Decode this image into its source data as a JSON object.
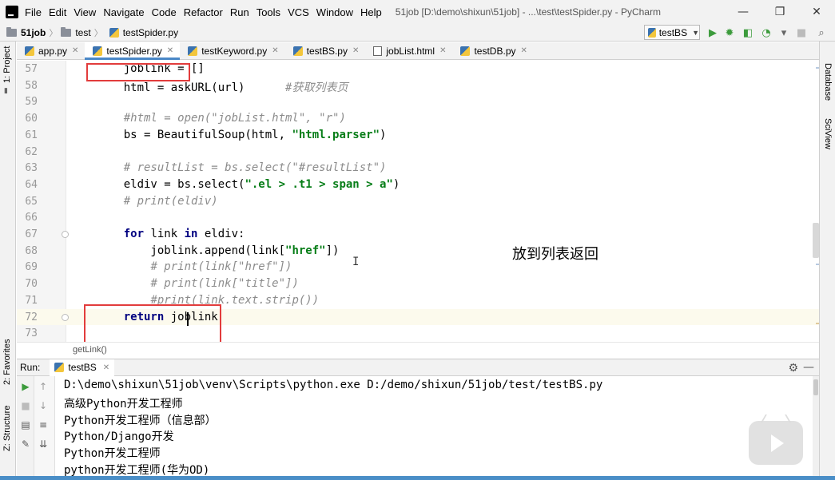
{
  "window": {
    "title": "51job [D:\\demo\\shixun\\51job] - ...\\test\\testSpider.py - PyCharm",
    "menu": [
      "File",
      "Edit",
      "View",
      "Navigate",
      "Code",
      "Refactor",
      "Run",
      "Tools",
      "VCS",
      "Window",
      "Help"
    ],
    "controls": {
      "minimize": "—",
      "restore": "❐",
      "close": "✕"
    }
  },
  "navbar": {
    "crumbs": [
      "51job",
      "test",
      "testSpider.py"
    ],
    "run_config": "testBS"
  },
  "left_stripe": {
    "top": "1: Project",
    "fav": "2: Favorites",
    "structure": "Z: Structure"
  },
  "right_stripe": {
    "top": "Database",
    "sci": "SciView"
  },
  "tabs": [
    {
      "label": "app.py",
      "type": "py",
      "active": false
    },
    {
      "label": "testSpider.py",
      "type": "py",
      "active": true
    },
    {
      "label": "testKeyword.py",
      "type": "py",
      "active": false
    },
    {
      "label": "testBS.py",
      "type": "py",
      "active": false
    },
    {
      "label": "jobList.html",
      "type": "html",
      "active": false
    },
    {
      "label": "testDB.py",
      "type": "py",
      "active": false
    }
  ],
  "editor": {
    "lines": [
      {
        "num": "57",
        "parts": [
          {
            "t": "    joblink = []",
            "c": "ident"
          }
        ]
      },
      {
        "num": "58",
        "parts": [
          {
            "t": "    html = askURL(url)      ",
            "c": "ident"
          },
          {
            "t": "#获取列表页",
            "c": "cmt"
          }
        ]
      },
      {
        "num": "59",
        "parts": []
      },
      {
        "num": "60",
        "parts": [
          {
            "t": "    ",
            "c": "ident"
          },
          {
            "t": "#html = open(\"jobList.html\", \"r\")",
            "c": "cmt"
          }
        ]
      },
      {
        "num": "61",
        "parts": [
          {
            "t": "    bs = BeautifulSoup(html, ",
            "c": "ident"
          },
          {
            "t": "\"html.parser\"",
            "c": "str"
          },
          {
            "t": ")",
            "c": "ident"
          }
        ]
      },
      {
        "num": "62",
        "parts": []
      },
      {
        "num": "63",
        "parts": [
          {
            "t": "    ",
            "c": "ident"
          },
          {
            "t": "# resultList = bs.select(\"#resultList\")",
            "c": "cmt"
          }
        ]
      },
      {
        "num": "64",
        "parts": [
          {
            "t": "    eldiv = bs.select(",
            "c": "ident"
          },
          {
            "t": "\".el > .t1 > span > a\"",
            "c": "str"
          },
          {
            "t": ")",
            "c": "ident"
          }
        ]
      },
      {
        "num": "65",
        "parts": [
          {
            "t": "    ",
            "c": "ident"
          },
          {
            "t": "# print(eldiv)",
            "c": "cmt"
          }
        ]
      },
      {
        "num": "66",
        "parts": []
      },
      {
        "num": "67",
        "parts": [
          {
            "t": "    ",
            "c": "ident"
          },
          {
            "t": "for",
            "c": "kw"
          },
          {
            "t": " link ",
            "c": "ident"
          },
          {
            "t": "in",
            "c": "kw"
          },
          {
            "t": " eldiv:",
            "c": "ident"
          }
        ]
      },
      {
        "num": "68",
        "parts": [
          {
            "t": "        joblink.append(link[",
            "c": "ident"
          },
          {
            "t": "\"href\"",
            "c": "str"
          },
          {
            "t": "])",
            "c": "ident"
          }
        ]
      },
      {
        "num": "69",
        "parts": [
          {
            "t": "        ",
            "c": "ident"
          },
          {
            "t": "# print(link[\"href\"])",
            "c": "cmt"
          }
        ]
      },
      {
        "num": "70",
        "parts": [
          {
            "t": "        ",
            "c": "ident"
          },
          {
            "t": "# print(link[\"title\"])",
            "c": "cmt"
          }
        ]
      },
      {
        "num": "71",
        "parts": [
          {
            "t": "        ",
            "c": "ident"
          },
          {
            "t": "#print(link.text.strip())",
            "c": "cmt"
          }
        ]
      },
      {
        "num": "72",
        "parts": [
          {
            "t": "    ",
            "c": "ident"
          },
          {
            "t": "return",
            "c": "kw"
          },
          {
            "t": " joblink",
            "c": "ident"
          }
        ],
        "current": true
      },
      {
        "num": "73",
        "parts": []
      }
    ],
    "annotation": "放到列表返回",
    "breadcrumb": "getLink()"
  },
  "run": {
    "label": "Run:",
    "tab": "testBS",
    "output": [
      "D:\\demo\\shixun\\51job\\venv\\Scripts\\python.exe D:/demo/shixun/51job/test/testBS.py",
      "高级Python开发工程师",
      "Python开发工程师（信息部）",
      "Python/Django开发",
      "Python开发工程师",
      "python开发工程师(华为OD)"
    ]
  },
  "colors": {
    "accent": "#4a88c7",
    "highlight": "#e23c3c",
    "keyword": "#000080",
    "string": "#067d17",
    "comment": "#8c8c8c"
  }
}
